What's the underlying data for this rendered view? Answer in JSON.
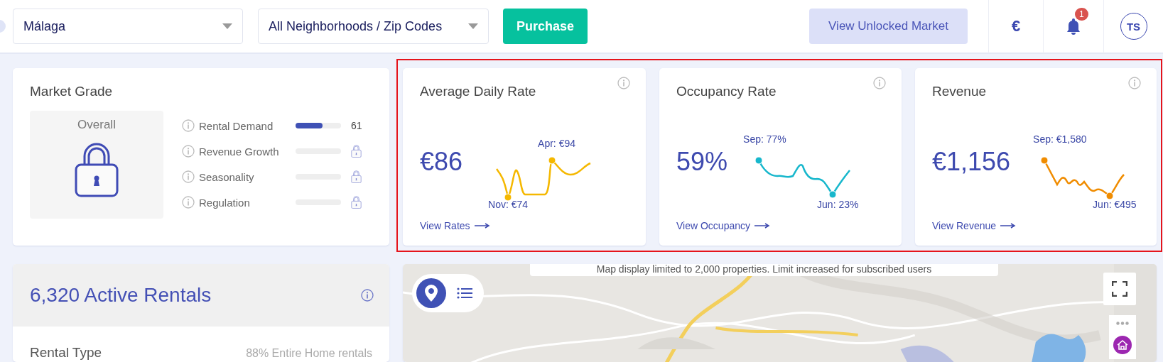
{
  "top_bar": {
    "city_select": {
      "value": "Málaga"
    },
    "area_select": {
      "value": "All Neighborhoods / Zip Codes"
    },
    "purchase_button": "Purchase",
    "unlock_button": "View Unlocked Market",
    "currency": "€",
    "notifications": {
      "count": "1"
    },
    "avatar": "TS"
  },
  "market_grade": {
    "title": "Market Grade",
    "overall": {
      "label": "Overall",
      "locked": true
    },
    "metrics": [
      {
        "name": "Rental Demand",
        "locked": false,
        "level": 0.6,
        "value": "61"
      },
      {
        "name": "Revenue Growth",
        "locked": true
      },
      {
        "name": "Seasonality",
        "locked": true
      },
      {
        "name": "Regulation",
        "locked": true
      }
    ]
  },
  "kpi_cards": [
    {
      "title": "Average Daily Rate",
      "value": "€86",
      "color": "#f5b800",
      "high": "Apr: €94",
      "low": "Nov: €74",
      "link": "View Rates"
    },
    {
      "title": "Occupancy Rate",
      "value": "59%",
      "color": "#17b7cc",
      "high": "Sep: 77%",
      "low": "Jun: 23%",
      "link": "View Occupancy"
    },
    {
      "title": "Revenue",
      "value": "€1,156",
      "color": "#f08c00",
      "high": "Sep: €1,580",
      "low": "Jun: €495",
      "link": "View Revenue"
    }
  ],
  "active_rentals": {
    "title": "6,320 Active Rentals",
    "rental_type": {
      "label": "Rental Type",
      "value": "88% Entire Home rentals"
    }
  },
  "map": {
    "kind": "picture",
    "notice": "Map display limited to 2,000 properties. Limit increased for subscribed users",
    "view_toggle": [
      {
        "kind": "pin",
        "selected": true
      },
      {
        "kind": "list",
        "selected": false
      }
    ]
  }
}
